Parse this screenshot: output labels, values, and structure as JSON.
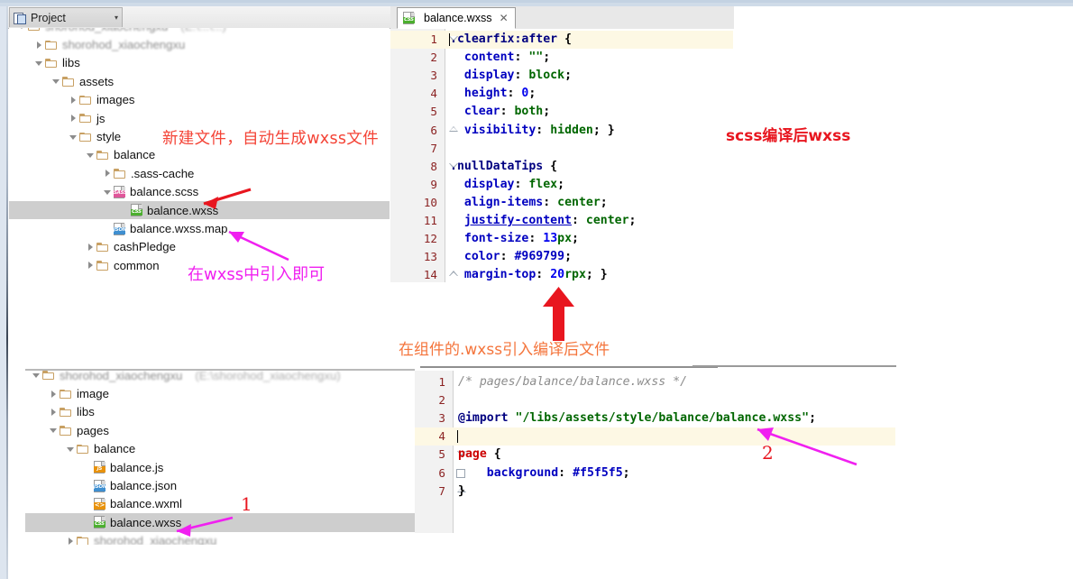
{
  "project_panel": {
    "tab_label": "Project",
    "tab_caret": "▾",
    "tools": [
      {
        "name": "locate-icon",
        "title": "Select Opened File"
      },
      {
        "name": "collapse-all-icon",
        "title": "Collapse All"
      },
      {
        "name": "settings-gear-icon",
        "title": "Settings"
      },
      {
        "name": "hide-panel-icon",
        "title": "Hide"
      }
    ],
    "tree": [
      {
        "depth": 0,
        "arrow": "down",
        "kind": "folder",
        "label": "",
        "blurred": true,
        "blur_extra": "(E:\\...\\...)"
      },
      {
        "depth": 1,
        "arrow": "right",
        "kind": "folder",
        "label": "",
        "blurred": true
      },
      {
        "depth": 1,
        "arrow": "down",
        "kind": "folder",
        "label": "libs"
      },
      {
        "depth": 2,
        "arrow": "down",
        "kind": "folder",
        "label": "assets"
      },
      {
        "depth": 3,
        "arrow": "right",
        "kind": "folder",
        "label": "images"
      },
      {
        "depth": 3,
        "arrow": "right",
        "kind": "folder",
        "label": "js"
      },
      {
        "depth": 3,
        "arrow": "down",
        "kind": "folder",
        "label": "style"
      },
      {
        "depth": 4,
        "arrow": "down",
        "kind": "folder",
        "label": "balance"
      },
      {
        "depth": 5,
        "arrow": "right",
        "kind": "folder",
        "label": ".sass-cache"
      },
      {
        "depth": 5,
        "arrow": "down",
        "kind": "sass",
        "label": "balance.scss"
      },
      {
        "depth": 6,
        "arrow": "none",
        "kind": "css",
        "label": "balance.wxss",
        "selected": true
      },
      {
        "depth": 5,
        "arrow": "none",
        "kind": "json",
        "label": "balance.wxss.map"
      },
      {
        "depth": 4,
        "arrow": "right",
        "kind": "folder",
        "label": "cashPledge"
      },
      {
        "depth": 4,
        "arrow": "right",
        "kind": "folder",
        "label": "common"
      }
    ]
  },
  "lower_panel": {
    "tree": [
      {
        "depth": 0,
        "arrow": "down",
        "kind": "folder",
        "label": "",
        "blurred": true,
        "blur_extra": "(E:\\shorohod_xiaochengxu)"
      },
      {
        "depth": 1,
        "arrow": "right",
        "kind": "folder",
        "label": "image"
      },
      {
        "depth": 1,
        "arrow": "right",
        "kind": "folder",
        "label": "libs"
      },
      {
        "depth": 1,
        "arrow": "down",
        "kind": "folder",
        "label": "pages"
      },
      {
        "depth": 2,
        "arrow": "down",
        "kind": "folder",
        "label": "balance"
      },
      {
        "depth": 3,
        "arrow": "none",
        "kind": "js",
        "label": "balance.js"
      },
      {
        "depth": 3,
        "arrow": "none",
        "kind": "json",
        "label": "balance.json"
      },
      {
        "depth": 3,
        "arrow": "none",
        "kind": "wxml",
        "label": "balance.wxml"
      },
      {
        "depth": 3,
        "arrow": "none",
        "kind": "css",
        "label": "balance.wxss",
        "selected": true
      },
      {
        "depth": 2,
        "arrow": "right",
        "kind": "folder",
        "label": "",
        "blurred": true
      }
    ]
  },
  "editor_top": {
    "tab": {
      "label": "balance.wxss",
      "icon": "css-file-icon",
      "close": "✕"
    },
    "lines": [
      {
        "n": "1",
        "tokens": [
          {
            "t": ".clearfix:after",
            "c": "sel-sel"
          },
          {
            "t": " {",
            "c": "punc"
          }
        ],
        "highlight": true,
        "fold": "top",
        "caret": true
      },
      {
        "n": "2",
        "tokens": [
          {
            "t": "  ",
            "c": "punc"
          },
          {
            "t": "content",
            "c": "prop"
          },
          {
            "t": ": ",
            "c": "punc"
          },
          {
            "t": "\"\"",
            "c": "val"
          },
          {
            "t": ";",
            "c": "punc"
          }
        ]
      },
      {
        "n": "3",
        "tokens": [
          {
            "t": "  ",
            "c": "punc"
          },
          {
            "t": "display",
            "c": "prop"
          },
          {
            "t": ": ",
            "c": "punc"
          },
          {
            "t": "block",
            "c": "val"
          },
          {
            "t": ";",
            "c": "punc"
          }
        ]
      },
      {
        "n": "4",
        "tokens": [
          {
            "t": "  ",
            "c": "punc"
          },
          {
            "t": "height",
            "c": "prop"
          },
          {
            "t": ": ",
            "c": "punc"
          },
          {
            "t": "0",
            "c": "num"
          },
          {
            "t": ";",
            "c": "punc"
          }
        ]
      },
      {
        "n": "5",
        "tokens": [
          {
            "t": "  ",
            "c": "punc"
          },
          {
            "t": "clear",
            "c": "prop"
          },
          {
            "t": ": ",
            "c": "punc"
          },
          {
            "t": "both",
            "c": "val"
          },
          {
            "t": ";",
            "c": "punc"
          }
        ]
      },
      {
        "n": "6",
        "tokens": [
          {
            "t": "  ",
            "c": "punc"
          },
          {
            "t": "visibility",
            "c": "prop"
          },
          {
            "t": ": ",
            "c": "punc"
          },
          {
            "t": "hidden",
            "c": "val"
          },
          {
            "t": "; }",
            "c": "punc"
          }
        ],
        "fold": "bottom"
      },
      {
        "n": "7",
        "tokens": []
      },
      {
        "n": "8",
        "tokens": [
          {
            "t": ".nullDataTips",
            "c": "sel-sel"
          },
          {
            "t": " {",
            "c": "punc"
          }
        ],
        "fold": "top"
      },
      {
        "n": "9",
        "tokens": [
          {
            "t": "  ",
            "c": "punc"
          },
          {
            "t": "display",
            "c": "prop"
          },
          {
            "t": ": ",
            "c": "punc"
          },
          {
            "t": "flex",
            "c": "val"
          },
          {
            "t": ";",
            "c": "punc"
          }
        ]
      },
      {
        "n": "10",
        "tokens": [
          {
            "t": "  ",
            "c": "punc"
          },
          {
            "t": "align-items",
            "c": "prop"
          },
          {
            "t": ": ",
            "c": "punc"
          },
          {
            "t": "center",
            "c": "val"
          },
          {
            "t": ";",
            "c": "punc"
          }
        ]
      },
      {
        "n": "11",
        "tokens": [
          {
            "t": "  ",
            "c": "punc"
          },
          {
            "t": "justify-content",
            "c": "prop-u"
          },
          {
            "t": ": ",
            "c": "punc"
          },
          {
            "t": "center",
            "c": "val"
          },
          {
            "t": ";",
            "c": "punc"
          }
        ]
      },
      {
        "n": "12",
        "tokens": [
          {
            "t": "  ",
            "c": "punc"
          },
          {
            "t": "font-size",
            "c": "prop"
          },
          {
            "t": ": ",
            "c": "punc"
          },
          {
            "t": "13",
            "c": "num"
          },
          {
            "t": "px",
            "c": "unit"
          },
          {
            "t": ";",
            "c": "punc"
          }
        ]
      },
      {
        "n": "13",
        "tokens": [
          {
            "t": "  ",
            "c": "punc"
          },
          {
            "t": "color",
            "c": "prop"
          },
          {
            "t": ": ",
            "c": "punc"
          },
          {
            "t": "#969799",
            "c": "hex"
          },
          {
            "t": ";",
            "c": "punc"
          }
        ]
      },
      {
        "n": "14",
        "tokens": [
          {
            "t": "  ",
            "c": "punc"
          },
          {
            "t": "margin-top",
            "c": "prop"
          },
          {
            "t": ": ",
            "c": "punc"
          },
          {
            "t": "20",
            "c": "num"
          },
          {
            "t": "rpx",
            "c": "unit"
          },
          {
            "t": "; }",
            "c": "punc"
          }
        ],
        "fold": "bottom"
      }
    ]
  },
  "editor_bottom": {
    "lines": [
      {
        "n": "1",
        "tokens": [
          {
            "t": "/* pages/balance/balance.wxss */",
            "c": "cmt"
          }
        ]
      },
      {
        "n": "2",
        "tokens": []
      },
      {
        "n": "3",
        "tokens": [
          {
            "t": "@import",
            "c": "atrule"
          },
          {
            "t": " ",
            "c": "punc"
          },
          {
            "t": "\"/libs/assets/style/balance/balance.wxss\"",
            "c": "str"
          },
          {
            "t": ";",
            "c": "punc"
          }
        ]
      },
      {
        "n": "4",
        "tokens": [],
        "highlight": true,
        "caret": true
      },
      {
        "n": "5",
        "tokens": [
          {
            "t": "page",
            "c": "pagekw"
          },
          {
            "t": " {",
            "c": "punc"
          }
        ],
        "fold": "top"
      },
      {
        "n": "6",
        "tokens": [
          {
            "t": "    ",
            "c": "punc"
          },
          {
            "t": "background",
            "c": "prop"
          },
          {
            "t": ": ",
            "c": "punc"
          },
          {
            "t": "#f5f5f5",
            "c": "hex"
          },
          {
            "t": ";",
            "c": "punc"
          }
        ],
        "fold": "box"
      },
      {
        "n": "7",
        "tokens": [
          {
            "t": "}",
            "c": "punc"
          }
        ],
        "fold": "bottom"
      }
    ]
  },
  "annotations": {
    "red_top_left": "新建文件，自动生成wxss文件",
    "red_top_right": "scss编译后wxss",
    "pink_mid_left": "在wxss中引入即可",
    "orange_mid": "在组件的.wxss引入编译后文件",
    "number_one": "1",
    "number_two": "2"
  },
  "colors": {
    "annotation_red": "#f44336",
    "annotation_red_bold": "#e8161f",
    "annotation_pink": "#f020f0",
    "annotation_orange": "#f4743b",
    "selection_gray": "#cecece",
    "line_highlight": "#fdf8e4"
  }
}
